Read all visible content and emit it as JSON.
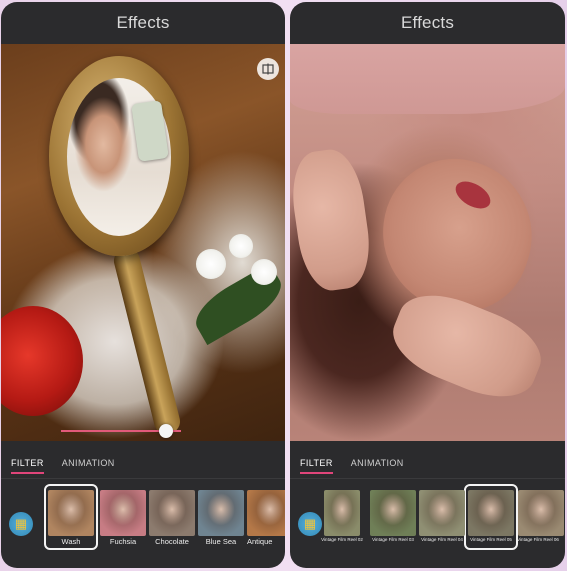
{
  "left_screen": {
    "title": "Effects",
    "tabs": [
      {
        "label": "FILTER",
        "active": true
      },
      {
        "label": "ANIMATION",
        "active": false
      }
    ],
    "filters": [
      {
        "label": "Wash",
        "selected": true,
        "color": "#b08560"
      },
      {
        "label": "Fuchsia",
        "selected": false,
        "color": "#c77c84"
      },
      {
        "label": "Chocolate",
        "selected": false,
        "color": "#8c7b6e"
      },
      {
        "label": "Blue Sea",
        "selected": false,
        "color": "#6f8491"
      },
      {
        "label": "Antique",
        "selected": false,
        "color": "#b47848"
      }
    ]
  },
  "right_screen": {
    "title": "Effects",
    "tabs": [
      {
        "label": "FILTER",
        "active": true
      },
      {
        "label": "ANIMATION",
        "active": false
      }
    ],
    "filters": [
      {
        "label": "Vintage Film Reel 02",
        "selected": false,
        "color": "#8a8c6a"
      },
      {
        "label": "Vintage Film Reel 03",
        "selected": false,
        "color": "#6f7f57"
      },
      {
        "label": "Vintage Film Reel 04",
        "selected": false,
        "color": "#8f8f73"
      },
      {
        "label": "Vintage Film Reel 05",
        "selected": true,
        "color": "#7c7763"
      },
      {
        "label": "Vintage Film Reel 06",
        "selected": false,
        "color": "#9a8a72"
      }
    ]
  },
  "accent_color": "#e0457a"
}
